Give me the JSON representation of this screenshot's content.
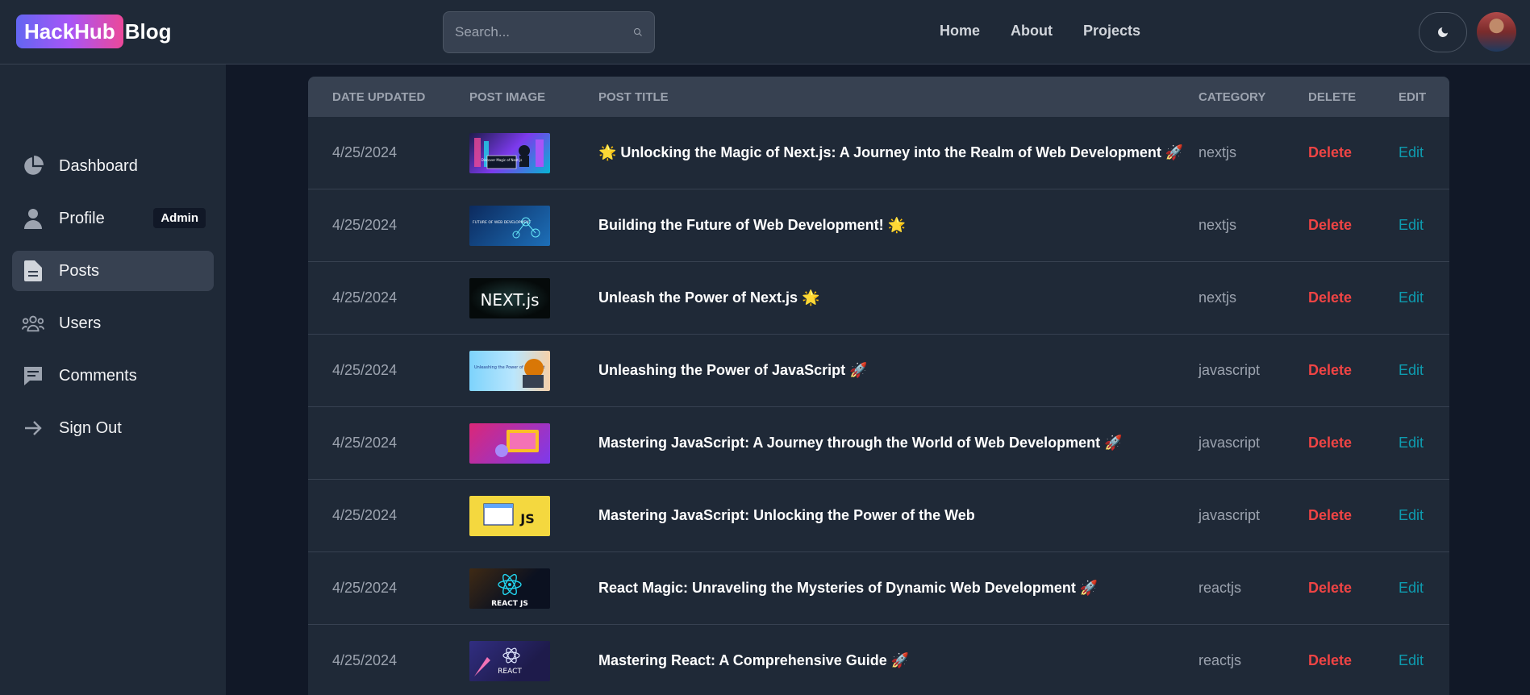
{
  "brand": {
    "badge": "HackHub",
    "rest": "Blog"
  },
  "search": {
    "placeholder": "Search..."
  },
  "nav": {
    "home": "Home",
    "about": "About",
    "projects": "Projects"
  },
  "sidebar": {
    "items": [
      {
        "label": "Dashboard",
        "icon": "pie-chart-icon"
      },
      {
        "label": "Profile",
        "icon": "user-icon",
        "badge": "Admin"
      },
      {
        "label": "Posts",
        "icon": "document-icon"
      },
      {
        "label": "Users",
        "icon": "users-icon"
      },
      {
        "label": "Comments",
        "icon": "comment-icon"
      },
      {
        "label": "Sign Out",
        "icon": "arrow-right-icon"
      }
    ]
  },
  "table": {
    "headers": [
      "Date updated",
      "Post image",
      "Post title",
      "Category",
      "Delete",
      "Edit"
    ],
    "rows": [
      {
        "date": "4/25/2024",
        "title": "🌟 Unlocking the Magic of Next.js: A Journey into the Realm of Web Development 🚀",
        "category": "nextjs",
        "delete": "Delete",
        "edit": "Edit"
      },
      {
        "date": "4/25/2024",
        "title": "Building the Future of Web Development! 🌟",
        "category": "nextjs",
        "delete": "Delete",
        "edit": "Edit"
      },
      {
        "date": "4/25/2024",
        "title": "Unleash the Power of Next.js 🌟",
        "category": "nextjs",
        "delete": "Delete",
        "edit": "Edit"
      },
      {
        "date": "4/25/2024",
        "title": "Unleashing the Power of JavaScript 🚀",
        "category": "javascript",
        "delete": "Delete",
        "edit": "Edit"
      },
      {
        "date": "4/25/2024",
        "title": "Mastering JavaScript: A Journey through the World of Web Development 🚀",
        "category": "javascript",
        "delete": "Delete",
        "edit": "Edit"
      },
      {
        "date": "4/25/2024",
        "title": "Mastering JavaScript: Unlocking the Power of the Web",
        "category": "javascript",
        "delete": "Delete",
        "edit": "Edit"
      },
      {
        "date": "4/25/2024",
        "title": "React Magic: Unraveling the Mysteries of Dynamic Web Development 🚀",
        "category": "reactjs",
        "delete": "Delete",
        "edit": "Edit"
      },
      {
        "date": "4/25/2024",
        "title": "Mastering React: A Comprehensive Guide 🚀",
        "category": "reactjs",
        "delete": "Delete",
        "edit": "Edit"
      }
    ],
    "thumb_texts": [
      "Discover Magic of Next.js",
      "FUTURE OF WEB DEVELOPMENT",
      "NEXT.js",
      "Unleashing the Power of JavaScript",
      "",
      "JS",
      "REACT JS",
      "REACT"
    ]
  },
  "colors": {
    "accent_delete": "#ef4444",
    "accent_edit": "#0e9cb0",
    "bg": "#111827",
    "panel": "#1f2937"
  }
}
